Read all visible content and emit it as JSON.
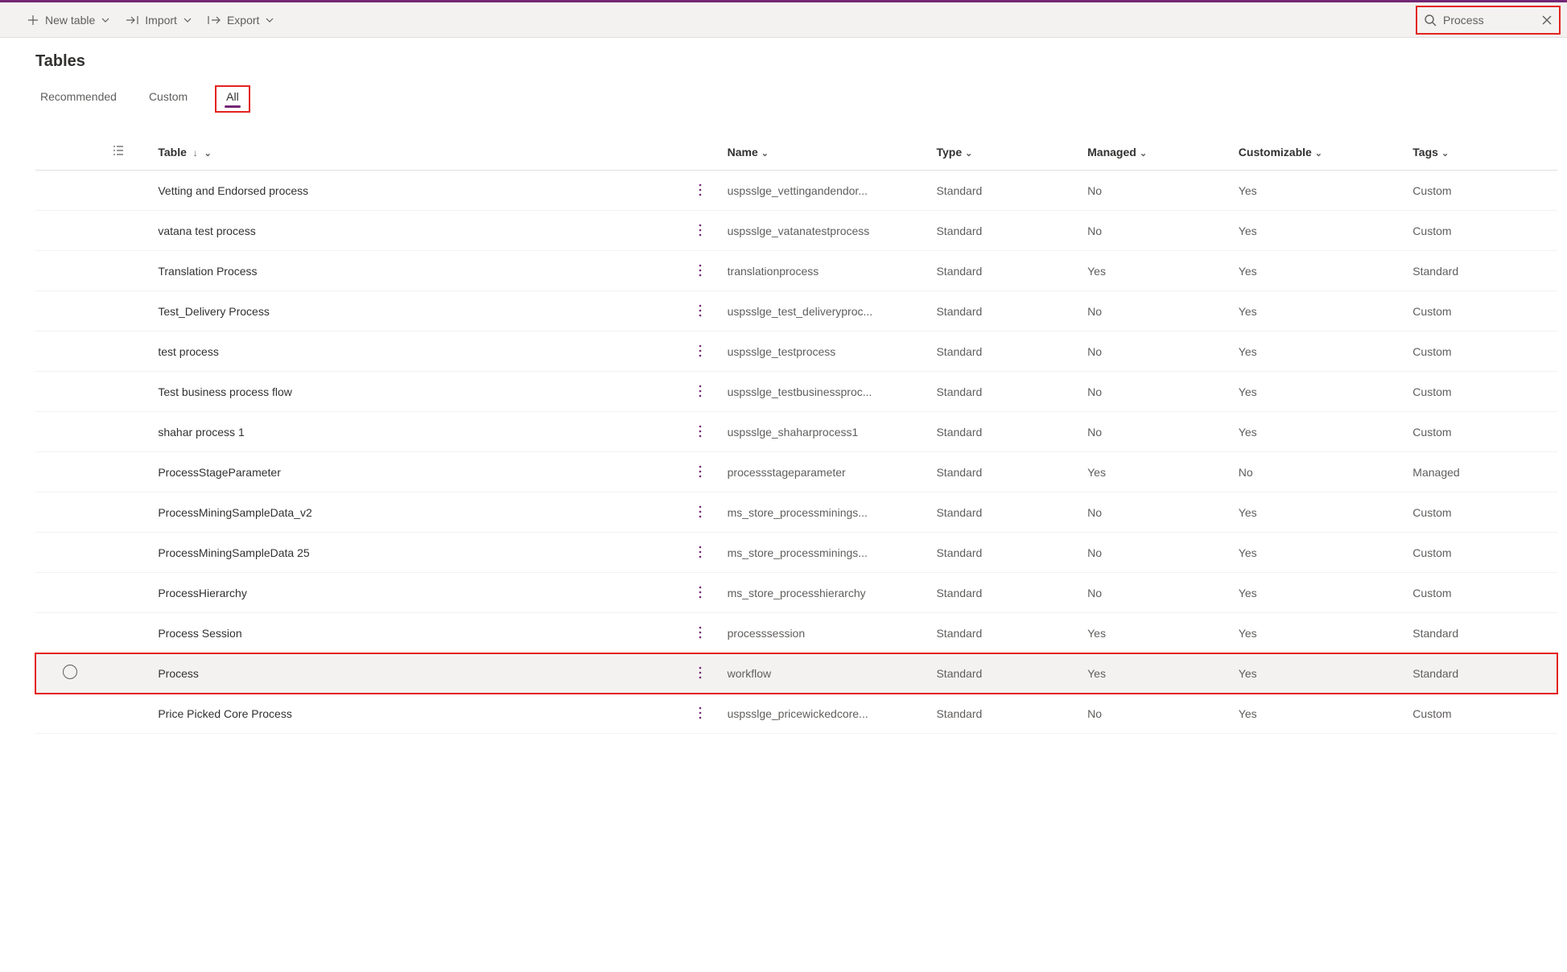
{
  "toolbar": {
    "new_table": "New table",
    "import": "Import",
    "export": "Export"
  },
  "search": {
    "value": "Process"
  },
  "page_title": "Tables",
  "tabs": {
    "recommended": "Recommended",
    "custom": "Custom",
    "all": "All"
  },
  "columns": {
    "table": "Table",
    "name": "Name",
    "type": "Type",
    "managed": "Managed",
    "customizable": "Customizable",
    "tags": "Tags"
  },
  "rows": [
    {
      "table": "Vetting and Endorsed process",
      "name": "uspsslge_vettingandendor...",
      "type": "Standard",
      "managed": "No",
      "customizable": "Yes",
      "tags": "Custom"
    },
    {
      "table": "vatana test process",
      "name": "uspsslge_vatanatestprocess",
      "type": "Standard",
      "managed": "No",
      "customizable": "Yes",
      "tags": "Custom"
    },
    {
      "table": "Translation Process",
      "name": "translationprocess",
      "type": "Standard",
      "managed": "Yes",
      "customizable": "Yes",
      "tags": "Standard"
    },
    {
      "table": "Test_Delivery Process",
      "name": "uspsslge_test_deliveryproc...",
      "type": "Standard",
      "managed": "No",
      "customizable": "Yes",
      "tags": "Custom"
    },
    {
      "table": "test process",
      "name": "uspsslge_testprocess",
      "type": "Standard",
      "managed": "No",
      "customizable": "Yes",
      "tags": "Custom"
    },
    {
      "table": "Test business process flow",
      "name": "uspsslge_testbusinessproc...",
      "type": "Standard",
      "managed": "No",
      "customizable": "Yes",
      "tags": "Custom"
    },
    {
      "table": "shahar process 1",
      "name": "uspsslge_shaharprocess1",
      "type": "Standard",
      "managed": "No",
      "customizable": "Yes",
      "tags": "Custom"
    },
    {
      "table": "ProcessStageParameter",
      "name": "processstageparameter",
      "type": "Standard",
      "managed": "Yes",
      "customizable": "No",
      "tags": "Managed"
    },
    {
      "table": "ProcessMiningSampleData_v2",
      "name": "ms_store_processminings...",
      "type": "Standard",
      "managed": "No",
      "customizable": "Yes",
      "tags": "Custom"
    },
    {
      "table": "ProcessMiningSampleData 25",
      "name": "ms_store_processminings...",
      "type": "Standard",
      "managed": "No",
      "customizable": "Yes",
      "tags": "Custom"
    },
    {
      "table": "ProcessHierarchy",
      "name": "ms_store_processhierarchy",
      "type": "Standard",
      "managed": "No",
      "customizable": "Yes",
      "tags": "Custom"
    },
    {
      "table": "Process Session",
      "name": "processsession",
      "type": "Standard",
      "managed": "Yes",
      "customizable": "Yes",
      "tags": "Standard"
    },
    {
      "table": "Process",
      "name": "workflow",
      "type": "Standard",
      "managed": "Yes",
      "customizable": "Yes",
      "tags": "Standard",
      "selected": true
    },
    {
      "table": "Price Picked Core Process",
      "name": "uspsslge_pricewickedcore...",
      "type": "Standard",
      "managed": "No",
      "customizable": "Yes",
      "tags": "Custom"
    }
  ]
}
